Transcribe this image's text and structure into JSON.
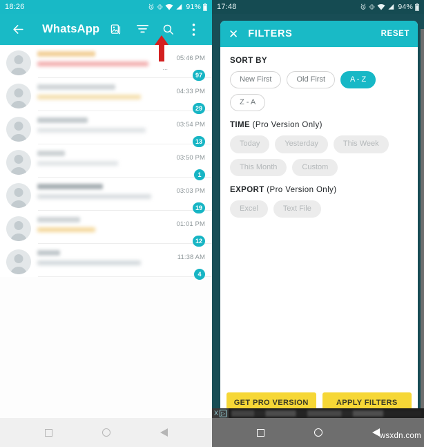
{
  "left_screen": {
    "status_bar": {
      "time": "18:26",
      "battery": "91%",
      "icons": [
        "alarm-icon",
        "vibrate-icon",
        "wifi-icon",
        "signal-icon",
        "battery-icon"
      ]
    },
    "app_bar": {
      "back_icon": "back-arrow-icon",
      "title": "WhatsApp",
      "actions": [
        "gallery-icon",
        "filter-icon",
        "search-icon",
        "overflow-menu-icon"
      ]
    },
    "annotation": {
      "type": "red-up-arrow",
      "color": "#d32020"
    },
    "chats": [
      {
        "time": "05:46 PM",
        "badge": "97",
        "name_blur": "#f0c98a",
        "msg_blur": "#f09a9a",
        "truncated": "..."
      },
      {
        "time": "04:33 PM",
        "badge": "29",
        "name_blur": "#c9cfd2",
        "msg_blur": "#f2d79a",
        "truncated": ""
      },
      {
        "time": "03:54 PM",
        "badge": "13",
        "name_blur": "#b9c1c5",
        "msg_blur": "#d8dde0",
        "truncated": ""
      },
      {
        "time": "03:50 PM",
        "badge": "1",
        "name_blur": "#c4cacd",
        "msg_blur": "#d9dee1",
        "truncated": ""
      },
      {
        "time": "03:03 PM",
        "badge": "19",
        "name_blur": "#9aa3a8",
        "msg_blur": "#d0d6d9",
        "truncated": ""
      },
      {
        "time": "01:01 PM",
        "badge": "12",
        "name_blur": "#c7cdd0",
        "msg_blur": "#f2cf84",
        "truncated": ""
      },
      {
        "time": "11:38 AM",
        "badge": "4",
        "name_blur": "#b7bfc3",
        "msg_blur": "#c9d0d4",
        "truncated": ""
      }
    ],
    "nav_bar": {
      "buttons": [
        "recents-square-icon",
        "home-circle-icon",
        "back-triangle-icon"
      ]
    }
  },
  "right_screen": {
    "status_bar": {
      "time": "17:48",
      "battery": "94%",
      "icons": [
        "alarm-icon",
        "vibrate-icon",
        "wifi-icon",
        "signal-icon",
        "battery-icon"
      ]
    },
    "sheet_header": {
      "close_icon": "close-x-icon",
      "title": "FILTERS",
      "reset_label": "RESET"
    },
    "sections": [
      {
        "key": "sort_by",
        "title": "SORT BY",
        "subtitle": "",
        "chips": [
          {
            "label": "New First",
            "state": "default"
          },
          {
            "label": "Old First",
            "state": "default"
          },
          {
            "label": "A - Z",
            "state": "active"
          },
          {
            "label": "Z - A",
            "state": "default"
          }
        ]
      },
      {
        "key": "time",
        "title": "TIME",
        "subtitle": " (Pro Version Only)",
        "chips": [
          {
            "label": "Today",
            "state": "disabled"
          },
          {
            "label": "Yesterday",
            "state": "disabled"
          },
          {
            "label": "This Week",
            "state": "disabled"
          },
          {
            "label": "This Month",
            "state": "disabled"
          },
          {
            "label": "Custom",
            "state": "disabled"
          }
        ]
      },
      {
        "key": "export",
        "title": "EXPORT",
        "subtitle": " (Pro Version Only)",
        "chips": [
          {
            "label": "Excel",
            "state": "disabled"
          },
          {
            "label": "Text File",
            "state": "disabled"
          }
        ]
      }
    ],
    "footer": {
      "get_pro_label": "GET PRO VERSION",
      "apply_label": "APPLY FILTERS",
      "button_color": "#f6d736"
    },
    "ad_bar": {
      "close_label": "X",
      "adchoices_label": "▷"
    },
    "nav_bar": {
      "buttons": [
        "recents-square-icon",
        "home-circle-icon",
        "back-triangle-icon"
      ]
    },
    "watermark": "wsxdn.com"
  },
  "colors": {
    "teal": "#19bac6",
    "dark_teal": "#184d55",
    "badge": "#17b5c4",
    "yellow": "#f6d736",
    "red_arrow": "#d32020"
  }
}
